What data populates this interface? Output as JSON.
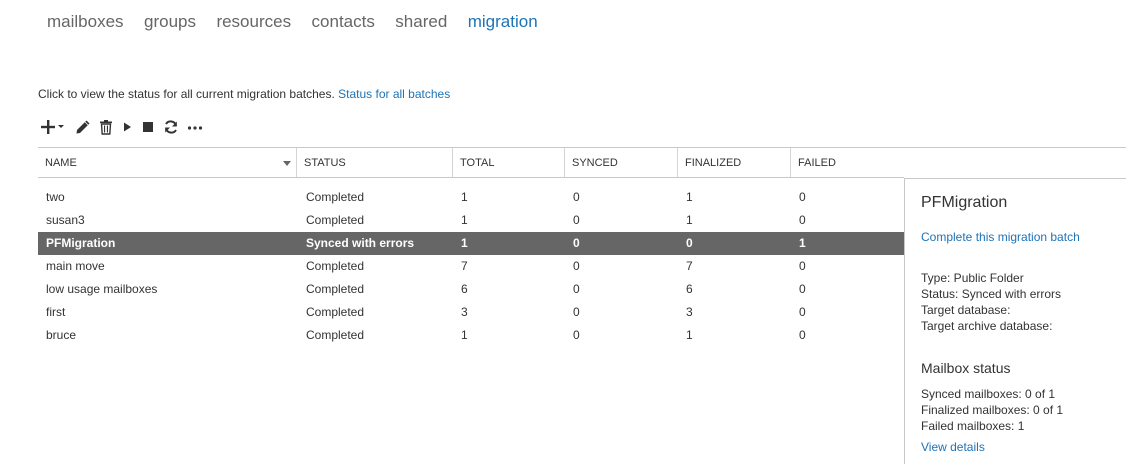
{
  "nav": {
    "items": [
      "mailboxes",
      "groups",
      "resources",
      "contacts",
      "shared",
      "migration"
    ],
    "active": "migration"
  },
  "info": {
    "text": "Click to view the status for all current migration batches.",
    "link": "Status for all batches"
  },
  "toolbar": {
    "icons": [
      "add-icon",
      "dropdown-caret-icon",
      "edit-icon",
      "delete-icon",
      "start-icon",
      "stop-icon",
      "refresh-icon",
      "more-icon"
    ]
  },
  "table": {
    "columns": [
      "NAME",
      "STATUS",
      "TOTAL",
      "SYNCED",
      "FINALIZED",
      "FAILED"
    ],
    "rows": [
      {
        "name": "two",
        "status": "Completed",
        "total": "1",
        "synced": "0",
        "finalized": "1",
        "failed": "0"
      },
      {
        "name": "susan3",
        "status": "Completed",
        "total": "1",
        "synced": "0",
        "finalized": "1",
        "failed": "0"
      },
      {
        "name": "PFMigration",
        "status": "Synced with errors",
        "total": "1",
        "synced": "0",
        "finalized": "0",
        "failed": "1"
      },
      {
        "name": "main move",
        "status": "Completed",
        "total": "7",
        "synced": "0",
        "finalized": "7",
        "failed": "0"
      },
      {
        "name": "low usage mailboxes",
        "status": "Completed",
        "total": "6",
        "synced": "0",
        "finalized": "6",
        "failed": "0"
      },
      {
        "name": "first",
        "status": "Completed",
        "total": "3",
        "synced": "0",
        "finalized": "3",
        "failed": "0"
      },
      {
        "name": "bruce",
        "status": "Completed",
        "total": "1",
        "synced": "0",
        "finalized": "1",
        "failed": "0"
      }
    ],
    "selected_row": "PFMigration"
  },
  "details": {
    "title": "PFMigration",
    "action_link": "Complete this migration batch",
    "type": "Type: Public Folder",
    "status": "Status: Synced with errors",
    "target_db": "Target database:",
    "target_archive_db": "Target archive database:",
    "mailbox_status_title": "Mailbox status",
    "synced": "Synced mailboxes: 0 of 1",
    "finalized": "Finalized mailboxes: 0 of 1",
    "failed": "Failed mailboxes: 1",
    "view_details": "View details"
  },
  "colors": {
    "accent": "#1e73b7",
    "selected_row_bg": "#666666",
    "nav_inactive": "#666666"
  }
}
